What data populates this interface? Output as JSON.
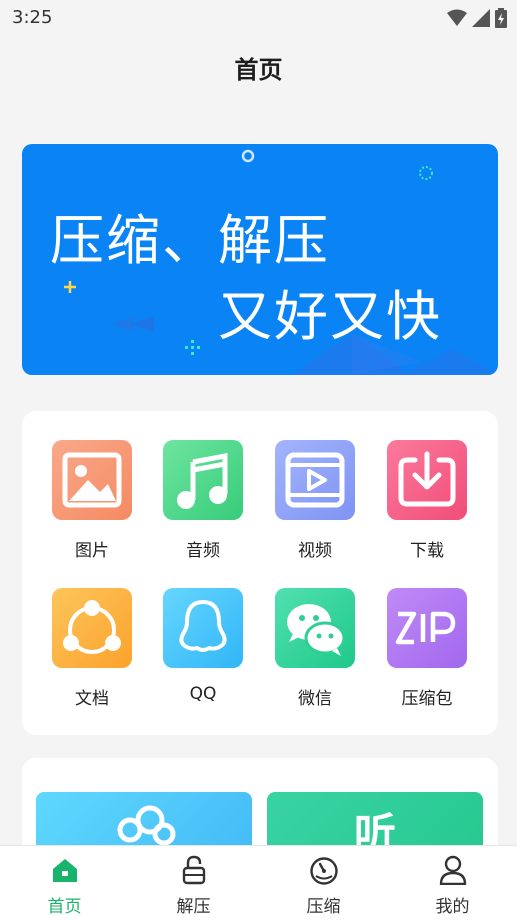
{
  "status_bar": {
    "time": "3:25",
    "icons": [
      "wifi-icon",
      "cell-signal-icon",
      "battery-charging-icon"
    ]
  },
  "header": {
    "title": "首页"
  },
  "banner": {
    "line1": "压缩、解压",
    "line2": "又好又快",
    "background": "#0a84f5"
  },
  "categories": [
    {
      "label": "图片",
      "icon": "image-icon",
      "color": "#f59a79"
    },
    {
      "label": "音频",
      "icon": "music-note-icon",
      "color": "#4fd68f"
    },
    {
      "label": "视频",
      "icon": "video-play-icon",
      "color": "#8fa6f8"
    },
    {
      "label": "下载",
      "icon": "download-icon",
      "color": "#f7628a"
    },
    {
      "label": "文档",
      "icon": "share-nodes-icon",
      "color": "#fdb13f"
    },
    {
      "label": "QQ",
      "icon": "qq-penguin-icon",
      "color": "#46c6fb"
    },
    {
      "label": "微信",
      "icon": "wechat-icon",
      "color": "#2fd59a"
    },
    {
      "label": "压缩包",
      "icon": "zip-archive-icon",
      "color": "#b07af1"
    }
  ],
  "feature_tiles": {
    "right_text": "听"
  },
  "tab_bar": {
    "active_color": "#19b46b",
    "tabs": [
      {
        "label": "首页",
        "icon": "home-icon",
        "active": true
      },
      {
        "label": "解压",
        "icon": "unlock-icon",
        "active": false
      },
      {
        "label": "压缩",
        "icon": "speedometer-icon",
        "active": false
      },
      {
        "label": "我的",
        "icon": "user-icon",
        "active": false
      }
    ]
  }
}
